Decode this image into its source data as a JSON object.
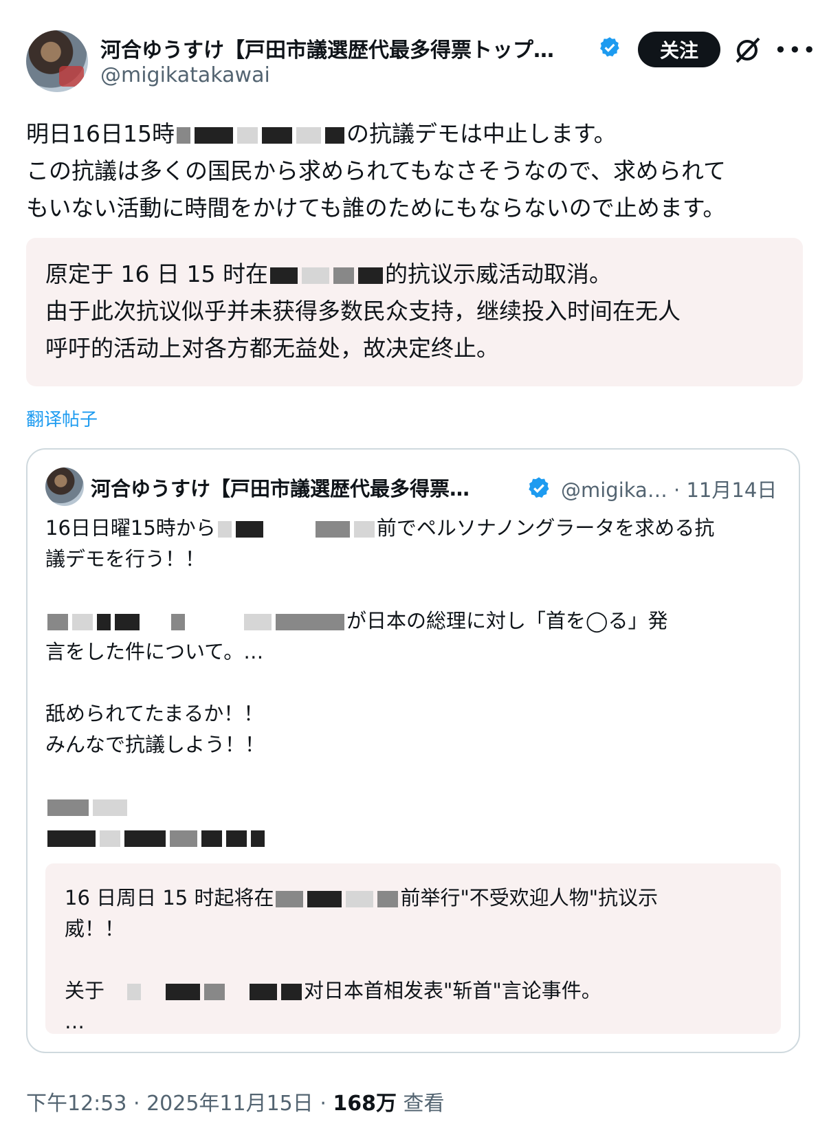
{
  "post": {
    "display_name": "河合ゆうすけ【戸田市議選歴代最多得票トップ…",
    "handle": "@migikatakawai",
    "follow_label": "关注",
    "body_lines": [
      {
        "before": "明日16日15時",
        "after": "の抗議デモは中止します。"
      },
      {
        "text": "この抗議は多くの国民から求められてもなさそうなので、求められて"
      },
      {
        "text": "もいない活動に時間をかけても誰のためにもならないので止めます。"
      }
    ],
    "translation_lines": [
      {
        "before": "原定于 16 日 15 时在",
        "after": "的抗议示威活动取消。"
      },
      {
        "text": "由于此次抗议似乎并未获得多数民众支持，继续投入时间在无人"
      },
      {
        "text": "呼吁的活动上对各方都无益处，故决定终止。"
      }
    ],
    "translate_link": "翻译帖子"
  },
  "quoted": {
    "display_name": "河合ゆうすけ【戸田市議選歴代最多得票…",
    "handle": "@migika…",
    "date": "· 11月14日",
    "lines": {
      "l1_before": "16日日曜15時から",
      "l1_after": "前でペルソナノングラータを求める抗",
      "l2": "議デモを行う！！",
      "l3_after": "が日本の総理に対し「首を◯る」発",
      "l4": "言をした件について。…",
      "l5": "舐められてたまるか！！",
      "l6": "みんなで抗議しよう！！"
    },
    "translation": {
      "t1_before": "16 日周日 15 时起将在",
      "t1_after": "前举行\"不受欢迎人物\"抗议示",
      "t2": "威！！",
      "t3_before": "关于",
      "t3_after": "对日本首相发表\"斩首\"言论事件。",
      "t4": "…"
    }
  },
  "meta": {
    "time": "下午12:53",
    "sep1": " · ",
    "date": "2025年11月15日",
    "sep2": " · ",
    "views_count": "168万",
    "views_label": " 查看"
  },
  "icons": {
    "verified": "verified-badge-icon",
    "grok": "grok-icon",
    "more": "more-icon"
  },
  "colors": {
    "accent": "#1d9bf0",
    "translation_bg": "#f9f1f1",
    "follow_bg": "#0f1419"
  }
}
